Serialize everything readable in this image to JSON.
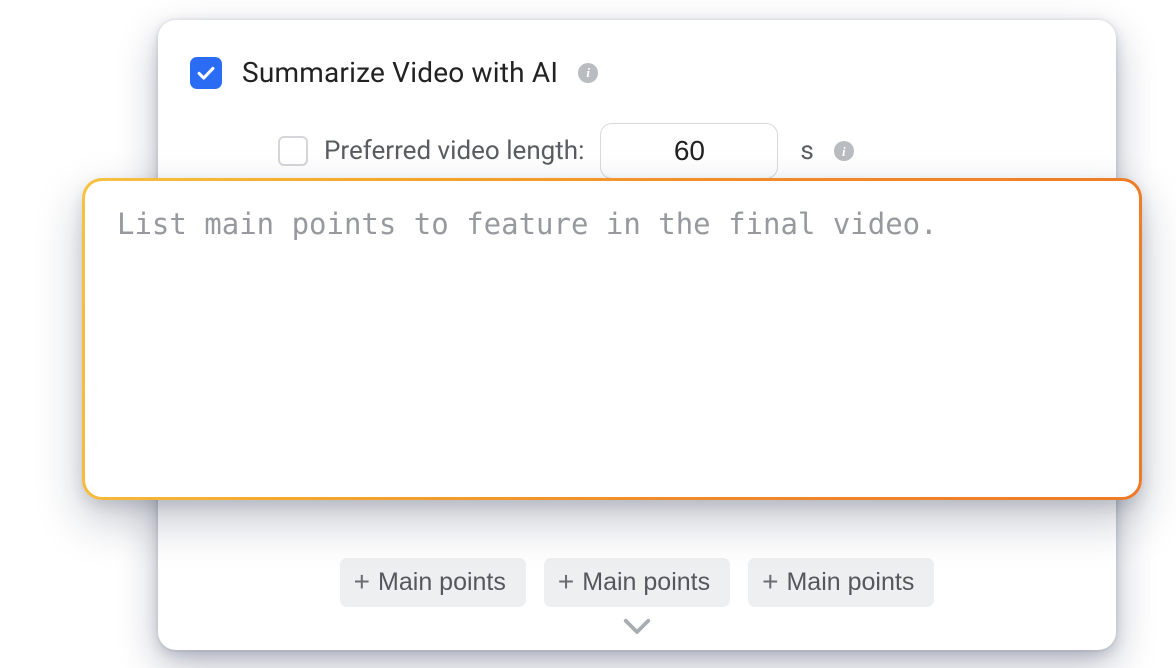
{
  "summarize": {
    "checked": true,
    "label": "Summarize Video with AI",
    "info_icon": "info-icon"
  },
  "preferred": {
    "checked": false,
    "label": "Preferred video length:",
    "value": "60",
    "unit": "s",
    "info_icon": "info-icon"
  },
  "textarea": {
    "placeholder": "List main points to feature in the final video.",
    "value": ""
  },
  "chips": [
    {
      "label": "Main points"
    },
    {
      "label": "Main points"
    },
    {
      "label": "Main points"
    }
  ],
  "icons": {
    "plus": "+",
    "info": "i"
  }
}
